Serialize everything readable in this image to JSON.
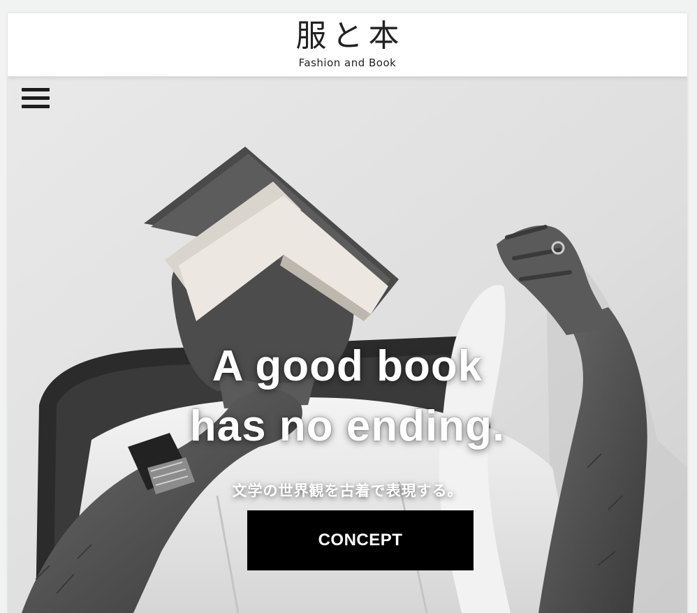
{
  "header": {
    "logo_jp": "服と本",
    "logo_en": "Fashion and Book"
  },
  "nav": {
    "menu_icon": "hamburger-menu-icon"
  },
  "hero": {
    "headline_line1": "A good book",
    "headline_line2": "has no ending.",
    "tagline": "文学の世界観を古着で表現する。",
    "cta_label": "CONCEPT",
    "image": "black-and-white photo of a seated man in a white shirt with an open book resting on his head"
  },
  "colors": {
    "header_bg": "#ffffff",
    "button_bg": "#000000",
    "button_text": "#ffffff",
    "hero_text": "#ffffff"
  }
}
